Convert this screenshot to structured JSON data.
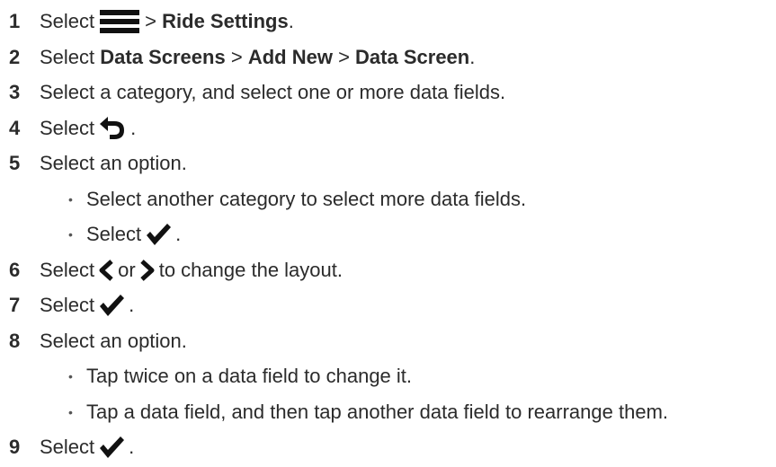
{
  "steps": [
    {
      "num": "1",
      "a": "Select",
      "b": ">",
      "c": "Ride Settings",
      "d": "."
    },
    {
      "num": "2",
      "a": "Select",
      "b": "Data Screens",
      "c": ">",
      "d": "Add New",
      "e": ">",
      "f": "Data Screen",
      "g": "."
    },
    {
      "num": "3",
      "a": "Select a category, and select one or more data fields."
    },
    {
      "num": "4",
      "a": "Select",
      "b": "."
    },
    {
      "num": "5",
      "a": "Select an option."
    },
    {
      "num": "6",
      "a": "Select",
      "b": "or",
      "c": "to change the layout."
    },
    {
      "num": "7",
      "a": "Select",
      "b": "."
    },
    {
      "num": "8",
      "a": "Select an option."
    },
    {
      "num": "9",
      "a": "Select",
      "b": "."
    }
  ],
  "bullets_step5": [
    {
      "dot": "•",
      "text": "Select another category to select more data fields."
    },
    {
      "dot": "•",
      "a": "Select",
      "b": "."
    }
  ],
  "bullets_step8": [
    {
      "dot": "•",
      "text": "Tap twice on a data field to change it."
    },
    {
      "dot": "•",
      "text": "Tap a data field, and then tap another data field to rearrange them."
    }
  ],
  "icons": {
    "menu": "menu-icon",
    "back": "back-arrow-icon",
    "check": "checkmark-icon",
    "left": "chevron-left-icon",
    "right": "chevron-right-icon"
  }
}
